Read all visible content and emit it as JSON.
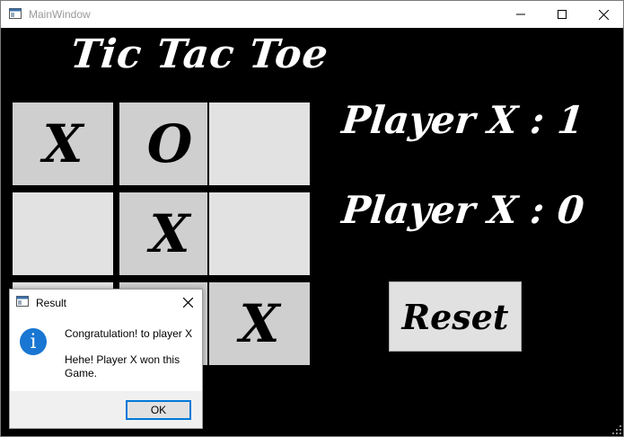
{
  "window": {
    "title": "MainWindow"
  },
  "game": {
    "title": "Tic Tac Toe",
    "board": [
      "X",
      "O",
      "",
      "",
      "X",
      "",
      "",
      "",
      "X"
    ],
    "scores": [
      "Player X : 1",
      "Player X : 0"
    ],
    "reset_label": "Reset"
  },
  "dialog": {
    "title": "Result",
    "message_line1": "Congratulation! to player X",
    "message_line2": "Hehe! Player X won this Game.",
    "ok_label": "OK",
    "icon": "info-icon"
  },
  "colors": {
    "cell_dark": "#cfcfcf",
    "cell_light": "#e2e2e2",
    "info_blue": "#1976d2",
    "focus_blue": "#0078d7"
  }
}
